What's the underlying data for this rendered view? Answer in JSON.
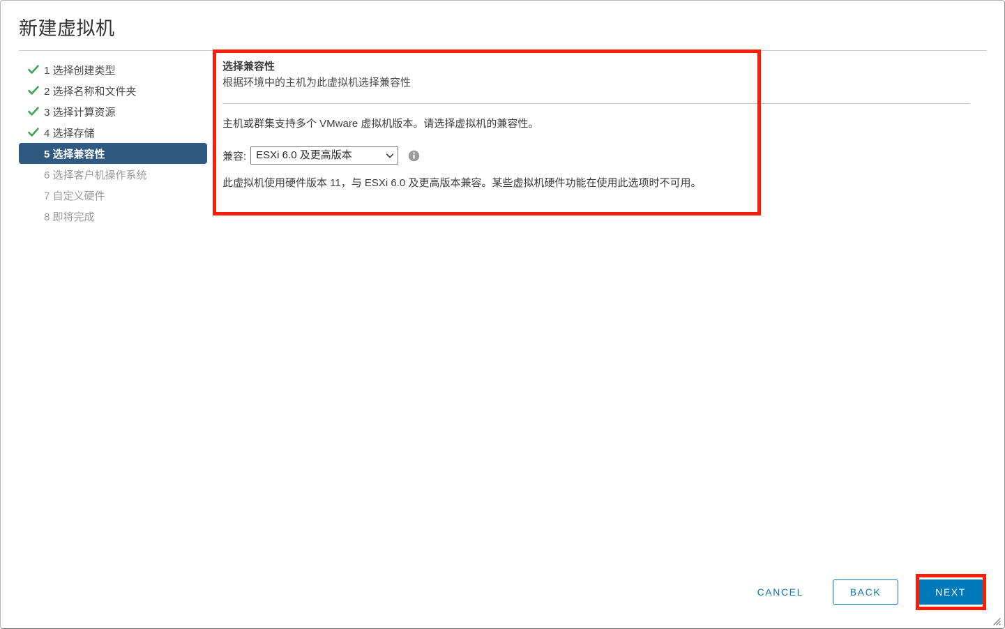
{
  "window": {
    "title": "新建虚拟机",
    "resize_grip_icon": "resize-grip-icon"
  },
  "steps": [
    {
      "number": "1",
      "label": "1 选择创建类型",
      "state": "done",
      "icon": "check-icon"
    },
    {
      "number": "2",
      "label": "2 选择名称和文件夹",
      "state": "done",
      "icon": "check-icon"
    },
    {
      "number": "3",
      "label": "3 选择计算资源",
      "state": "done",
      "icon": "check-icon"
    },
    {
      "number": "4",
      "label": "4 选择存储",
      "state": "done",
      "icon": "check-icon"
    },
    {
      "number": "5",
      "label": "5 选择兼容性",
      "state": "current",
      "icon": "none"
    },
    {
      "number": "6",
      "label": "6 选择客户机操作系统",
      "state": "pending",
      "icon": "none"
    },
    {
      "number": "7",
      "label": "7 自定义硬件",
      "state": "pending",
      "icon": "none"
    },
    {
      "number": "8",
      "label": "8 即将完成",
      "state": "pending",
      "icon": "none"
    }
  ],
  "content": {
    "heading": "选择兼容性",
    "subheading": "根据环境中的主机为此虚拟机选择兼容性",
    "body_text": "主机或群集支持多个 VMware 虚拟机版本。请选择虚拟机的兼容性。",
    "compat_label": "兼容:",
    "compat_value": "ESXi 6.0 及更高版本",
    "compat_options": [
      "ESXi 6.0 及更高版本"
    ],
    "compat_caret_icon": "chevron-down-icon",
    "info_icon": "info-icon",
    "note_text": "此虚拟机使用硬件版本 11，与 ESXi 6.0 及更高版本兼容。某些虚拟机硬件功能在使用此选项时不可用。"
  },
  "footer": {
    "cancel_label": "CANCEL",
    "back_label": "BACK",
    "next_label": "NEXT"
  },
  "colors": {
    "accent_blue": "#0079b8",
    "link_blue": "#0b78b5",
    "selected_step_bg": "#2e5a82",
    "check_green": "#3aa655",
    "annotation_red": "#fc1d09",
    "title_text": "#313131"
  },
  "annotations": [
    {
      "name": "compatibility-panel-highlight",
      "color": "#fc1d09"
    },
    {
      "name": "next-button-highlight",
      "color": "#fc1d09"
    }
  ]
}
